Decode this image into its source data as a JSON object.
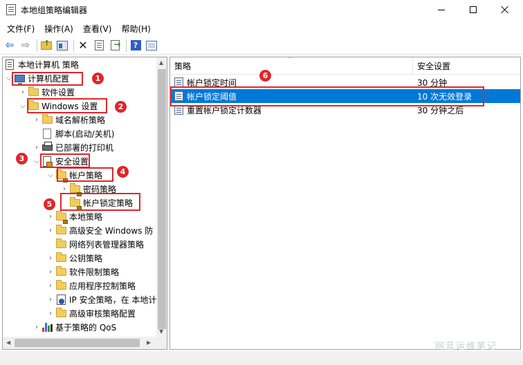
{
  "window": {
    "title": "本地组策略编辑器"
  },
  "menu": [
    "文件(F)",
    "操作(A)",
    "查看(V)",
    "帮助(H)"
  ],
  "toolbar": {
    "icons": [
      "back-arrow-icon",
      "forward-arrow-icon",
      "up-folder-icon",
      "show-hide-tree-icon",
      "delete-icon",
      "properties-icon",
      "export-list-icon",
      "help-icon",
      "mmc-console-icon"
    ],
    "help_glyph": "?"
  },
  "tree": {
    "root": "本地计算机 策略",
    "computer_config": "计算机配置",
    "software_settings": "软件设置",
    "windows_settings": "Windows 设置",
    "name_resolution": "域名解析策略",
    "scripts": "脚本(启动/关机)",
    "printers": "已部署的打印机",
    "security_settings": "安全设置",
    "account_policies": "帐户策略",
    "password_policy": "密码策略",
    "lockout_policy": "帐户锁定策略",
    "local_policies": "本地策略",
    "firewall": "高级安全 Windows 防",
    "network_list": "网络列表管理器策略",
    "public_key": "公钥策略",
    "software_restriction": "软件限制策略",
    "app_control": "应用程序控制策略",
    "ipsec": "IP 安全策略，在 本地计",
    "audit": "高级审核策略配置",
    "qos": "基于策略的 QoS"
  },
  "list": {
    "header_policy": "策略",
    "header_setting": "安全设置",
    "rows": [
      {
        "policy": "帐户锁定时间",
        "setting": "30 分钟"
      },
      {
        "policy": "帐户锁定阈值",
        "setting": "10 次无效登录"
      },
      {
        "policy": "重置帐户锁定计数器",
        "setting": "30 分钟之后"
      }
    ]
  },
  "annotations": [
    "1",
    "2",
    "3",
    "4",
    "5",
    "6"
  ],
  "watermark": "网蓝运维笔记",
  "colors": {
    "selection": "#0078d7",
    "annotation_red": "#e0262b",
    "folder_yellow": "#f2cd5c"
  }
}
